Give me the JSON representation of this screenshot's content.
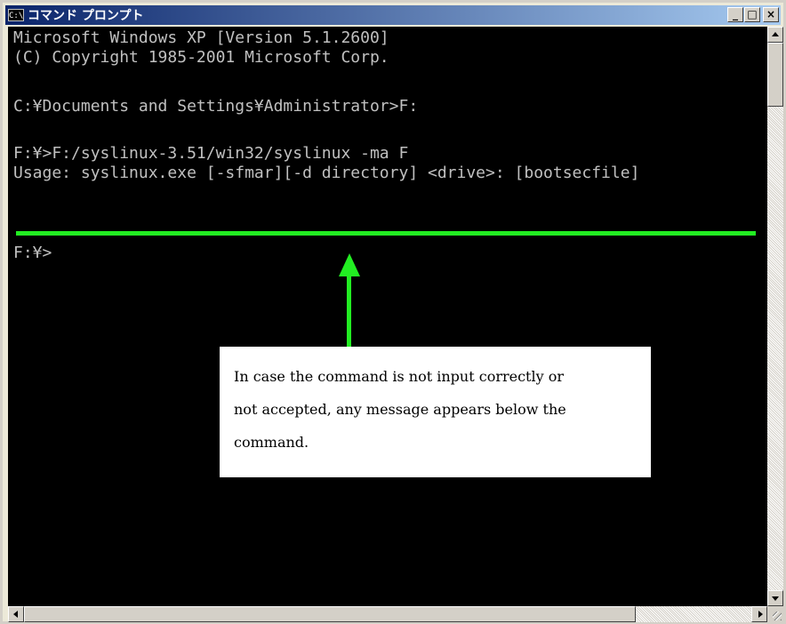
{
  "window": {
    "title": "コマンド プロンプト",
    "icon_label": "C:\\",
    "icon": "console-icon",
    "buttons": {
      "minimize": "_",
      "maximize": "□",
      "close": "×"
    }
  },
  "console": {
    "lines": [
      "Microsoft Windows XP [Version 5.1.2600]",
      "(C) Copyright 1985-2001 Microsoft Corp.",
      "",
      "C:¥Documents and Settings¥Administrator>F:",
      "",
      "F:¥>F:/syslinux-3.51/win32/syslinux -ma F",
      "Usage: syslinux.exe [-sfmar][-d directory] <drive>: [bootsecfile]",
      "",
      "F:¥>"
    ],
    "text_color": "#c0c0c0",
    "background": "#000000"
  },
  "annotation": {
    "lines": [
      "In case the command is not input correctly or",
      "not accepted, any message appears below the",
      "command."
    ],
    "highlight_color": "#22ee22"
  },
  "scrollbars": {
    "vertical_thumb": "top",
    "horizontal_thumb": "left"
  }
}
